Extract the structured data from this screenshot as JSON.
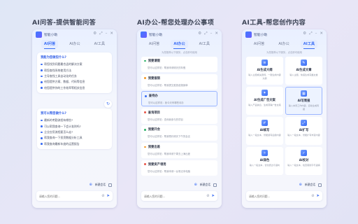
{
  "panels": [
    {
      "title": "AI问答-提供智能问答"
    },
    {
      "title": "AI办公-帮您处理办公事项"
    },
    {
      "title": "AI工具-帮您创作内容"
    }
  ],
  "window": {
    "app_name": "智能小助",
    "controls": [
      "⚙",
      "⤢",
      "–",
      "✕"
    ]
  },
  "tabs": [
    "AI问答",
    "AI办公",
    "AI工具"
  ],
  "qa": {
    "q1": {
      "header": "我能为您做些什么?",
      "items": [
        "帮您找到问题最合适的解决方案",
        "帮您查找系统使用方法",
        "主导查找工具自动化的任务",
        "给您提供方案、数据、代码等信息",
        "给您提供你的工作效率等相关信息"
      ]
    },
    "q2": {
      "header": "我可以帮您做什么?",
      "items": [
        "最新的考勤流程有哪些?",
        "可以帮我查询一下会计准则吗?",
        "企业应用流程要怎么走?",
        "帮我查询一下投资数据分析工具",
        "帮我查询最新年度的运营报告"
      ]
    },
    "new_chat": "新建会话",
    "input_placeholder": "请输入您的问题..."
  },
  "office": {
    "hint": "为您推荐以下服务，点击即可使用",
    "items": [
      {
        "title": "我要请假",
        "desc": "您可以这样说：帮我申请明天的年假",
        "color": "#2fb36b"
      },
      {
        "title": "我要报销",
        "desc": "您可以这样说：帮我提交差旅费报销单",
        "color": "#f29b2f"
      },
      {
        "title": "查待办",
        "desc": "您可以这样说：我今天有哪些待办",
        "color": "#3b6ef5"
      },
      {
        "title": "查询项目",
        "desc": "您可以这样说：查询我参与的项目",
        "color": "#e8584d"
      },
      {
        "title": "我要开会",
        "desc": "您可以这样说：帮我预约明天下午的会议",
        "color": "#2fb36b"
      },
      {
        "title": "我要出差",
        "desc": "您可以这样说：帮我申请下周去上海出差",
        "color": "#f29b2f"
      },
      {
        "title": "我要资产领用",
        "desc": "您可以这样说：帮我申请一台笔记本电脑",
        "color": "#e8584d"
      }
    ],
    "new_chat": "新建会话",
    "input_placeholder": "请输入您的问题..."
  },
  "tools": {
    "hint": "为您推荐以下服务，点击即可使用",
    "items": [
      {
        "name": "AI生成大纲",
        "desc": "输入主题或关键词，一键生成内容大纲",
        "glyph": "≡"
      },
      {
        "name": "AI生成文章",
        "desc": "输入主题，快速生成完整文章",
        "glyph": "✎"
      },
      {
        "name": "AI生成广告文案",
        "desc": "输入产品信息，生成营销广告文案",
        "glyph": "✦"
      },
      {
        "name": "AI写周报",
        "desc": "输入本周工作内容，自动生成周报",
        "glyph": "▦"
      },
      {
        "name": "AI续写",
        "desc": "输入一段文本，智能续写后续内容",
        "glyph": "✐"
      },
      {
        "name": "AI扩写",
        "desc": "输入一段文本，智能扩写丰富内容",
        "glyph": "⤢"
      },
      {
        "name": "AI润色",
        "desc": "输入一段文本，优化表达与语句",
        "glyph": "✧"
      },
      {
        "name": "AI校对",
        "desc": "输入一段文本，检查错别字与语病",
        "glyph": "✓"
      }
    ],
    "new_chat": "新建会话",
    "input_placeholder": "请输入您的问题..."
  }
}
